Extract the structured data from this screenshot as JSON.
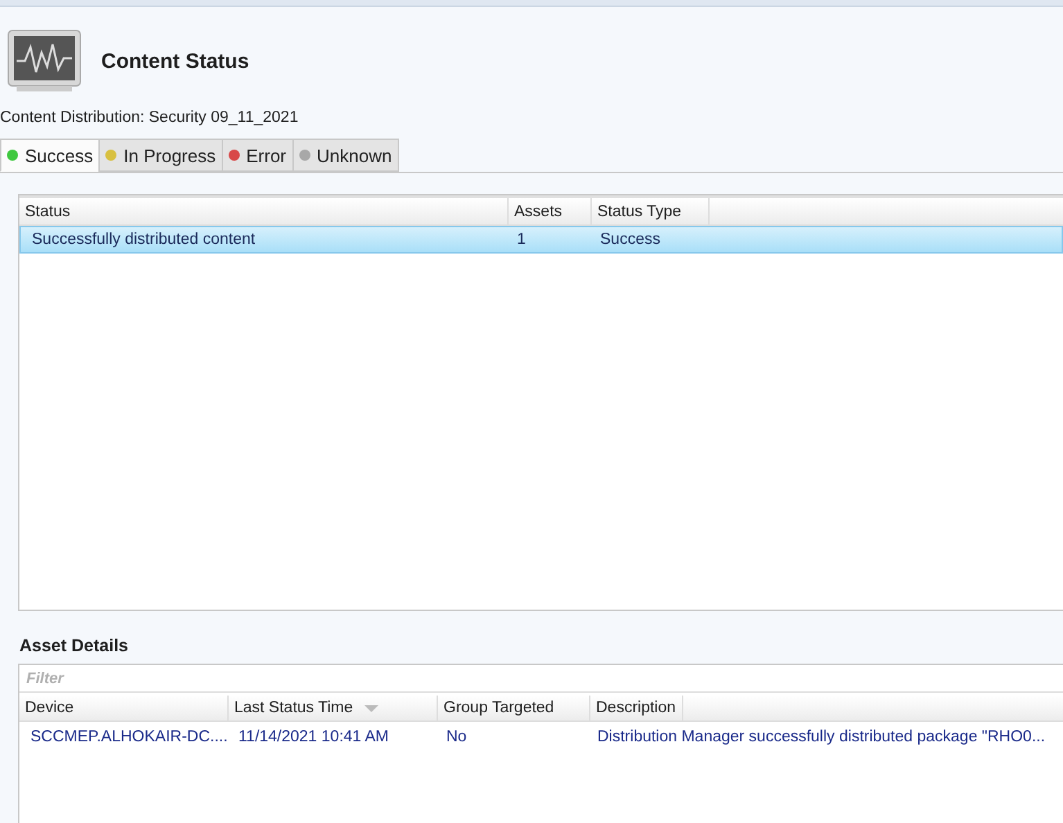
{
  "header": {
    "title": "Content Status",
    "subtitle": "Content Distribution:  Security 09_11_2021"
  },
  "tabs": [
    {
      "label": "Success",
      "color": "#3fc83f",
      "selected": true
    },
    {
      "label": "In Progress",
      "color": "#d8c040",
      "selected": false
    },
    {
      "label": "Error",
      "color": "#d84848",
      "selected": false
    },
    {
      "label": "Unknown",
      "color": "#a8a8a8",
      "selected": false
    }
  ],
  "status_table": {
    "columns": [
      "Status",
      "Assets",
      "Status Type"
    ],
    "rows": [
      {
        "cells": [
          "Successfully distributed content",
          "1",
          "Success"
        ],
        "selected": true
      }
    ]
  },
  "asset_details": {
    "title": "Asset Details",
    "filter": {
      "placeholder": "Filter"
    },
    "columns": [
      {
        "label": "Device",
        "sorted": false
      },
      {
        "label": "Last Status Time",
        "sorted": true
      },
      {
        "label": "Group Targeted",
        "sorted": false
      },
      {
        "label": "Description",
        "sorted": false
      }
    ],
    "rows": [
      {
        "cells": [
          "SCCMEP.ALHOKAIR-DC....",
          "11/14/2021 10:41 AM",
          "No",
          "Distribution Manager successfully distributed package \"RHO0..."
        ]
      }
    ]
  }
}
